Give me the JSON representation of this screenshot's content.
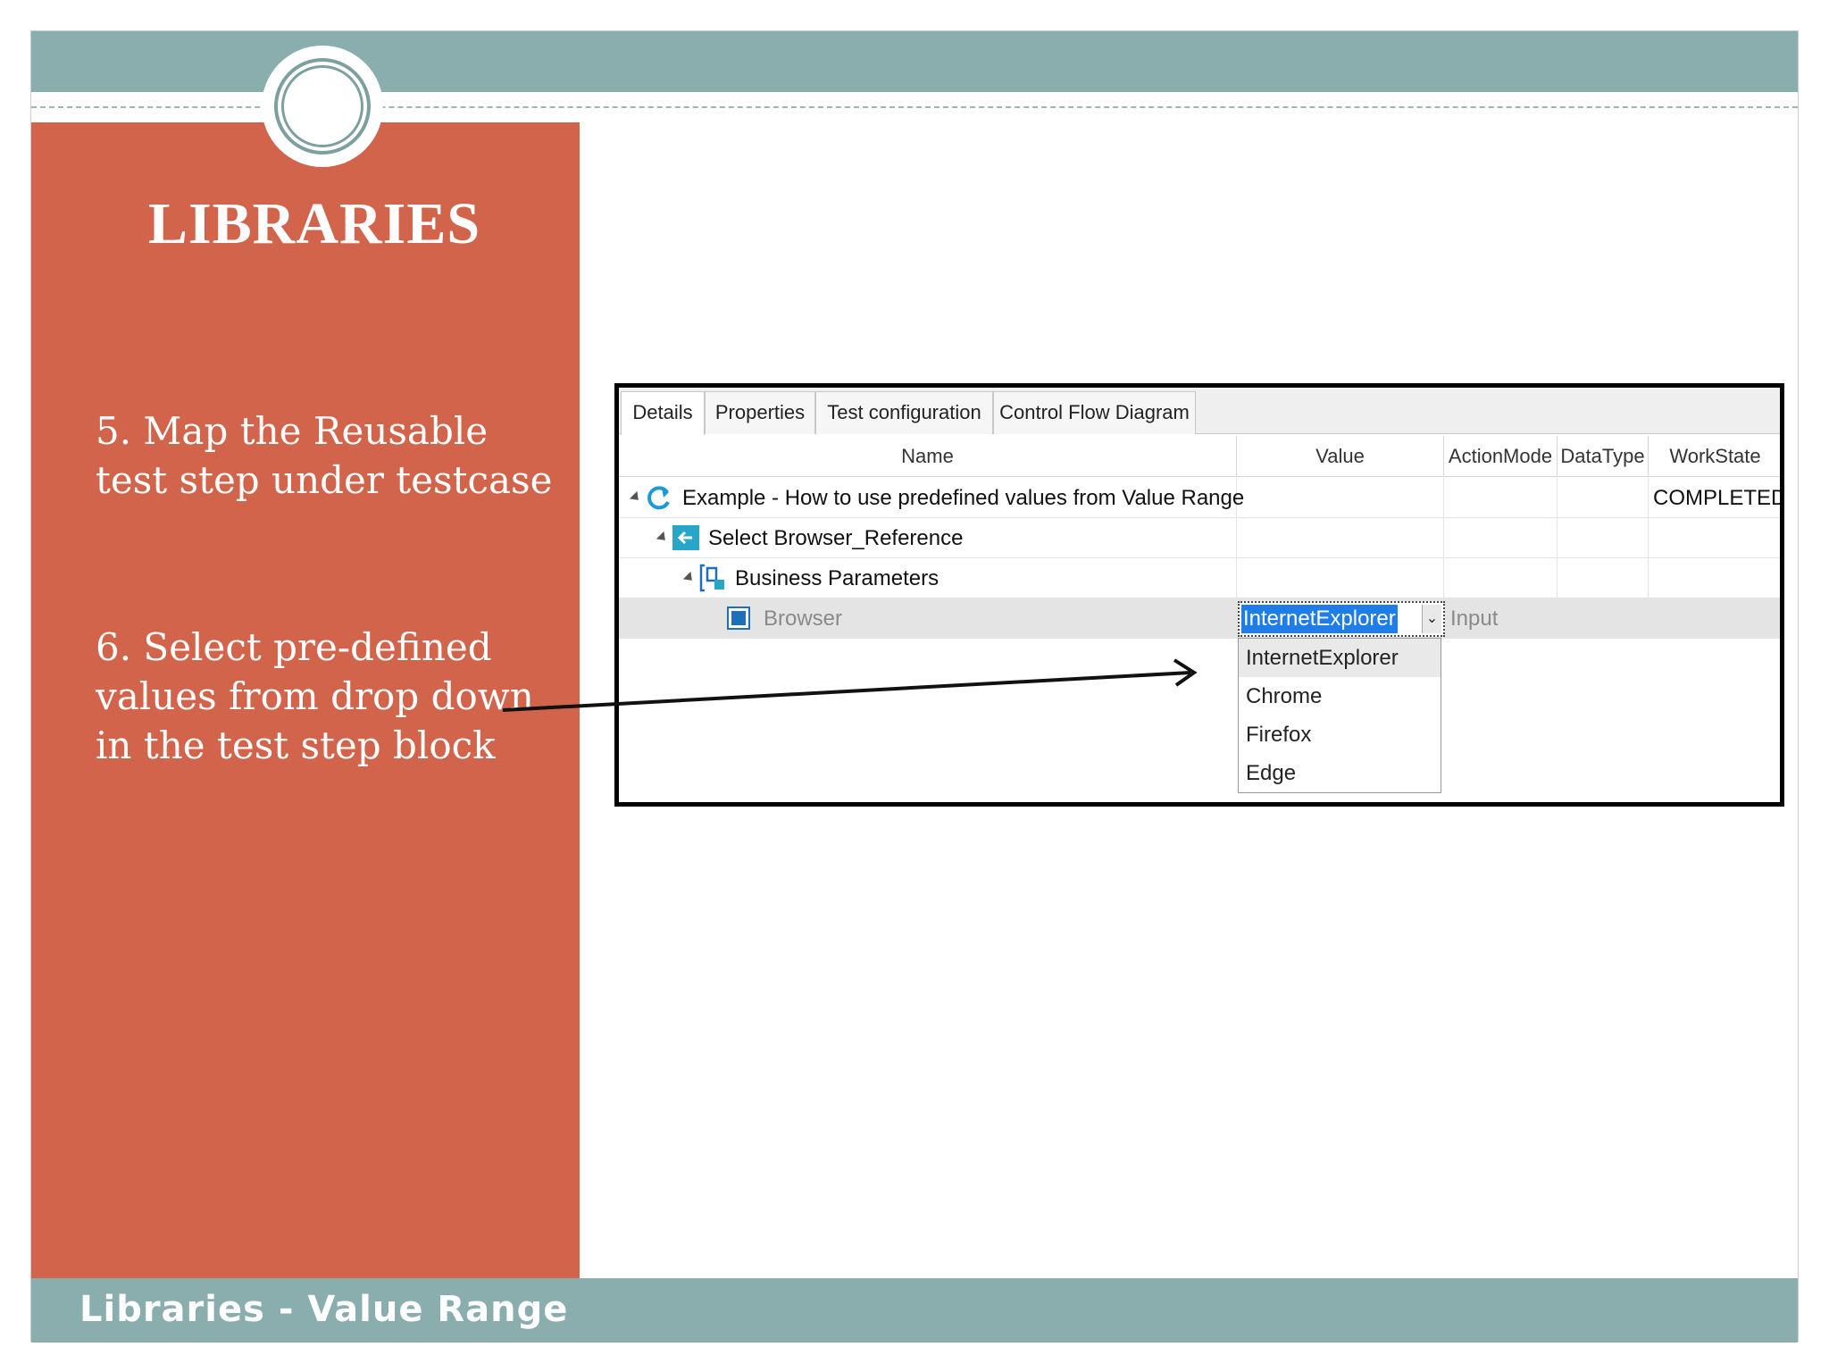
{
  "slide": {
    "title": "LIBRARIES",
    "step5": "5. Map the Reusable\ntest step under testcase",
    "step6": "6. Select pre-defined\nvalues from drop down\nin the test step block",
    "footer": "Libraries - Value Range"
  },
  "colors": {
    "teal_band": "#8aadad",
    "left_panel": "#d1644a",
    "selection_blue": "#1f7de8"
  },
  "app": {
    "tabs": [
      "Details",
      "Properties",
      "Test configuration",
      "Control Flow Diagram"
    ],
    "active_tab": "Details",
    "columns": [
      "Name",
      "Value",
      "ActionMode",
      "DataType",
      "WorkState"
    ],
    "rows": [
      {
        "name": "Example - How to use predefined values from Value Range",
        "icon": "refresh-icon",
        "workstate": "COMPLETED"
      },
      {
        "name": "Select Browser_Reference",
        "icon": "reusable-step-icon"
      },
      {
        "name": "Business Parameters",
        "icon": "parameters-icon"
      },
      {
        "name": "Browser",
        "icon": "parameter-icon",
        "value": "InternetExplorer",
        "actionmode": "Input"
      }
    ],
    "dropdown": {
      "options": [
        "InternetExplorer",
        "Chrome",
        "Firefox",
        "Edge"
      ],
      "highlighted": "InternetExplorer"
    },
    "icons": {
      "combo_arrow": "chevron-down-icon"
    }
  }
}
